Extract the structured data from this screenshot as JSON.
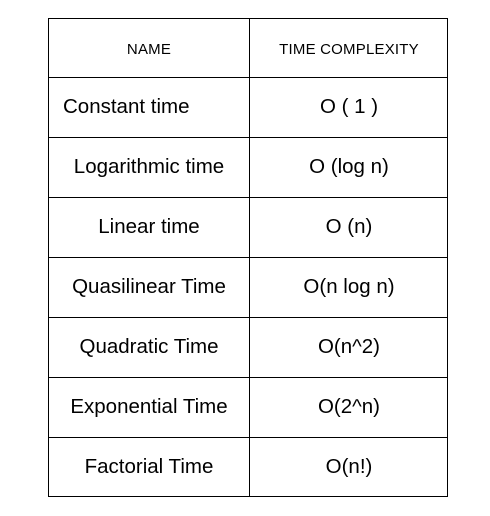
{
  "table": {
    "headers": [
      "NAME",
      "TIME COMPLEXITY"
    ],
    "rows": [
      [
        "Constant time",
        "O ( 1 )"
      ],
      [
        "Logarithmic time",
        "O (log n)"
      ],
      [
        "Linear time",
        "O (n)"
      ],
      [
        "Quasilinear Time",
        "O(n log n)"
      ],
      [
        "Quadratic Time",
        "O(n^2)"
      ],
      [
        "Exponential Time",
        "O(2^n)"
      ],
      [
        "Factorial Time",
        "O(n!)"
      ]
    ]
  }
}
